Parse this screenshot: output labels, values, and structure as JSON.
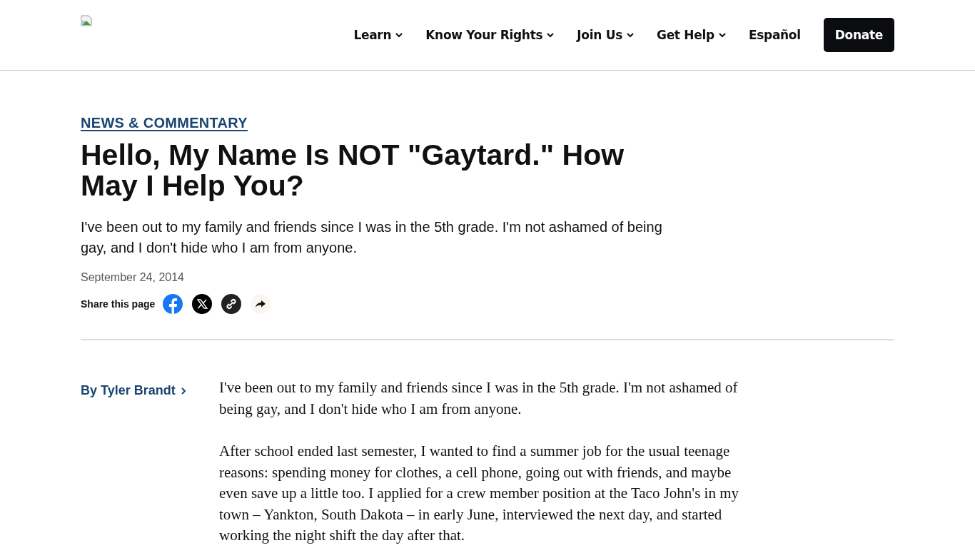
{
  "nav": {
    "items": [
      {
        "label": "Learn",
        "has_menu": true
      },
      {
        "label": "Know Your Rights",
        "has_menu": true
      },
      {
        "label": "Join Us",
        "has_menu": true
      },
      {
        "label": "Get Help",
        "has_menu": true
      },
      {
        "label": "Español",
        "has_menu": false
      }
    ],
    "donate": "Donate"
  },
  "article": {
    "category": "NEWS & COMMENTARY",
    "title": "Hello, My Name Is NOT \"Gaytard.\" How May I Help You?",
    "dek": "I've been out to my family and friends since I was in the 5th grade. I'm not ashamed of being gay, and I don't hide who I am from anyone.",
    "date": "September 24, 2014",
    "share_label": "Share this page",
    "share_buttons": [
      {
        "kind": "facebook"
      },
      {
        "kind": "x"
      },
      {
        "kind": "link"
      },
      {
        "kind": "share"
      }
    ],
    "byline_prefix": "By",
    "author": "Tyler Brandt",
    "paragraphs": [
      "I've been out to my family and friends since I was in the 5th grade. I'm not ashamed of being gay, and I don't hide who I am from anyone.",
      "After school ended last semester, I wanted to find a summer job for the usual teenage reasons: spending money for clothes, a cell phone, going out with friends, and maybe even save up a little too. I applied for a crew member position at the Taco John's in my town – Yankton, South Dakota – in early June, interviewed the next day, and started working the night shift the day after that."
    ]
  }
}
